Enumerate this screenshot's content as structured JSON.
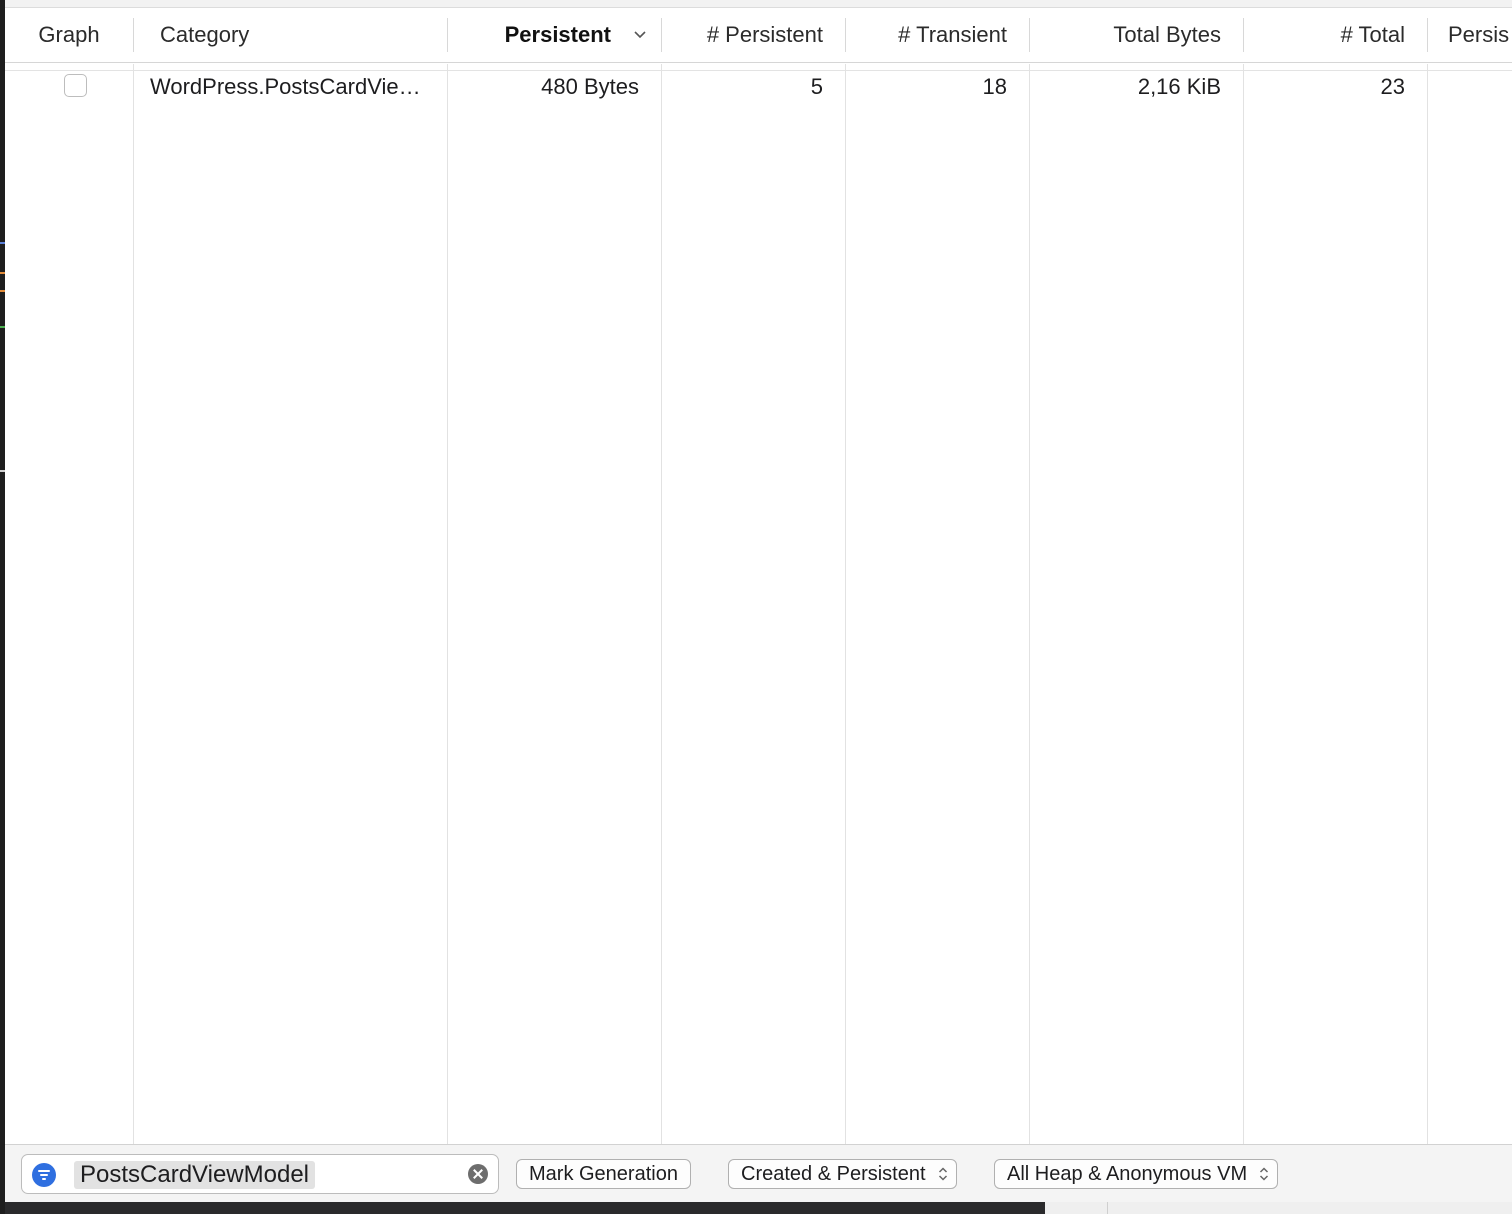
{
  "columns": [
    {
      "key": "graph",
      "label": "Graph"
    },
    {
      "key": "category",
      "label": "Category"
    },
    {
      "key": "persistent",
      "label": "Persistent",
      "sorted": true
    },
    {
      "key": "num_persistent",
      "label": "# Persistent"
    },
    {
      "key": "num_transient",
      "label": "# Transient"
    },
    {
      "key": "total_bytes",
      "label": "Total Bytes"
    },
    {
      "key": "num_total",
      "label": "# Total"
    },
    {
      "key": "persis_clipped",
      "label": "Persis"
    }
  ],
  "rows": [
    {
      "graph_checked": false,
      "category": "WordPress.PostsCardVie…",
      "persistent": "480 Bytes",
      "num_persistent": "5",
      "num_transient": "18",
      "total_bytes": "2,16 KiB",
      "num_total": "23"
    }
  ],
  "filter": {
    "value": "PostsCardViewModel",
    "icon": "filter-icon",
    "clear_icon": "clear-icon"
  },
  "toolbar": {
    "mark_generation_label": "Mark Generation",
    "allocation_lifespan": "Created & Persistent",
    "allocation_type": "All Heap & Anonymous VM"
  },
  "colors": {
    "accent": "#2f6fe0",
    "grid_line": "#e2e2e2"
  }
}
